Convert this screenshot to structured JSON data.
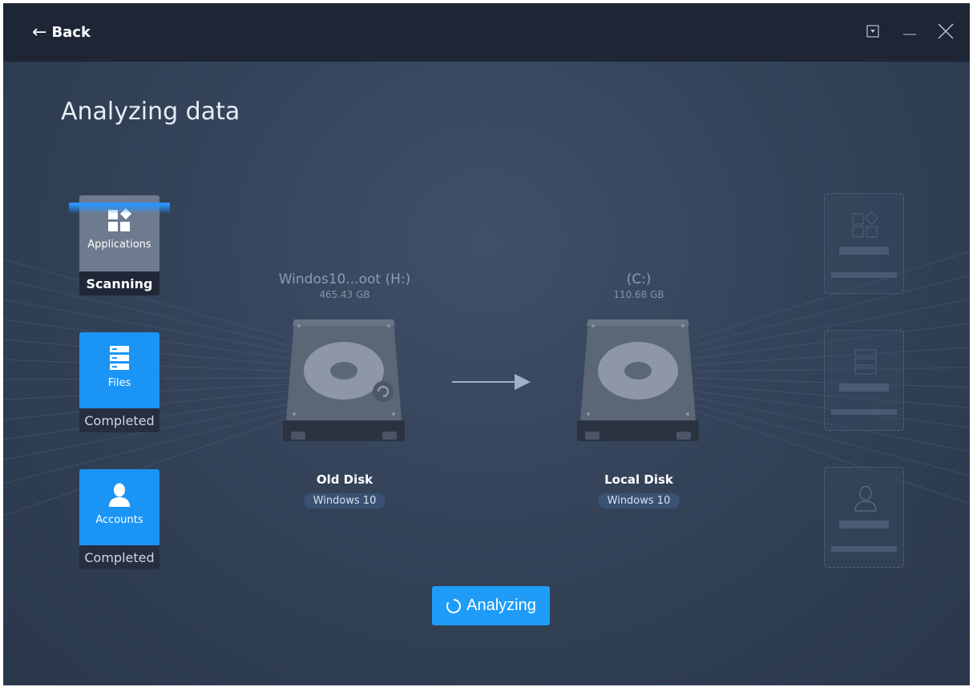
{
  "header": {
    "back_label": "Back",
    "icons": [
      "back-arrow-icon",
      "dropdown-icon",
      "minimize-icon",
      "close-icon"
    ]
  },
  "page": {
    "title": "Analyzing data"
  },
  "categories": [
    {
      "label": "Applications",
      "status": "Scanning",
      "icon": "applications-icon"
    },
    {
      "label": "Files",
      "status": "Completed",
      "icon": "files-icon"
    },
    {
      "label": "Accounts",
      "status": "Completed",
      "icon": "user-icon"
    }
  ],
  "source_disk": {
    "name": "Windos10...oot (H:)",
    "size": "465.43 GB",
    "label": "Old Disk",
    "os": "Windows 10"
  },
  "target_disk": {
    "name": "(C:)",
    "size": "110.68 GB",
    "label": "Local Disk",
    "os": "Windows 10"
  },
  "action": {
    "label": "Analyzing",
    "icon": "spinner-icon"
  },
  "colors": {
    "accent": "#1e9cf7",
    "titlebar": "#1e2636",
    "background": "#344359"
  }
}
